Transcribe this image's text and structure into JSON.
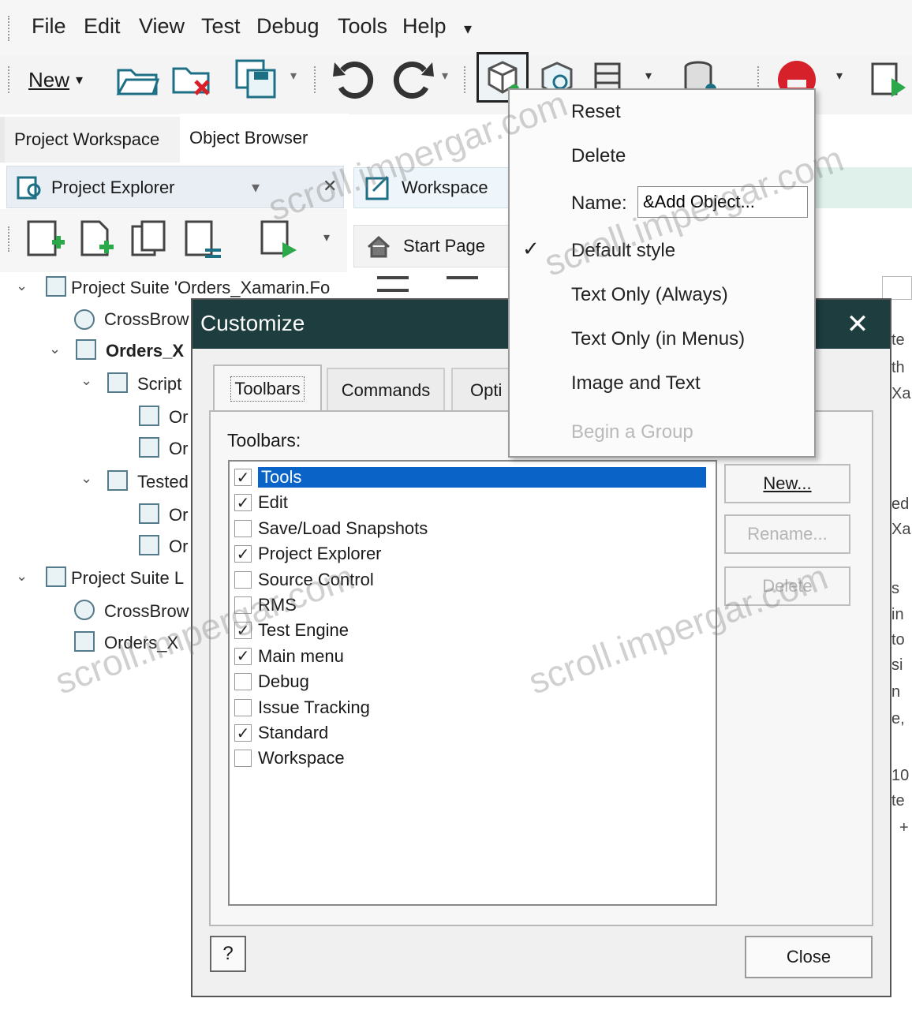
{
  "menubar": {
    "items": [
      "File",
      "Edit",
      "View",
      "Test",
      "Debug",
      "Tools",
      "Help"
    ],
    "more": "▾"
  },
  "toolbar": {
    "new_label": "New",
    "dropdown_arrow": "▾"
  },
  "left_panel": {
    "tabs": [
      "Project Workspace",
      "Object Browser"
    ],
    "explorer_title": "Project Explorer",
    "tree": [
      {
        "label": "Project Suite 'Orders_Xamarin.Fo",
        "level": 0
      },
      {
        "label": "CrossBrow",
        "level": 1
      },
      {
        "label": "Orders_X",
        "level": 1
      },
      {
        "label": "Script",
        "level": 2
      },
      {
        "label": "Or",
        "level": 3
      },
      {
        "label": "Or",
        "level": 3
      },
      {
        "label": "Tested",
        "level": 2
      },
      {
        "label": "Or",
        "level": 3
      },
      {
        "label": "Or",
        "level": 3
      },
      {
        "label": "Project Suite L",
        "level": 0
      },
      {
        "label": "CrossBrow",
        "level": 1
      },
      {
        "label": "Orders_X",
        "level": 1
      }
    ]
  },
  "workspace": {
    "tab_label": "Workspace",
    "start_page": "Start Page"
  },
  "dialog": {
    "title": "Customize",
    "close_glyph": "✕",
    "tabs": [
      "Toolbars",
      "Commands",
      "Opti"
    ],
    "toolbars_label": "Toolbars:",
    "toolbars": [
      {
        "name": "Tools",
        "checked": true,
        "selected": true
      },
      {
        "name": "Edit",
        "checked": true,
        "selected": false
      },
      {
        "name": "Save/Load Snapshots",
        "checked": false,
        "selected": false
      },
      {
        "name": "Project Explorer",
        "checked": true,
        "selected": false
      },
      {
        "name": "Source Control",
        "checked": false,
        "selected": false
      },
      {
        "name": "RMS",
        "checked": false,
        "selected": false
      },
      {
        "name": "Test Engine",
        "checked": true,
        "selected": false
      },
      {
        "name": "Main menu",
        "checked": true,
        "selected": false
      },
      {
        "name": "Debug",
        "checked": false,
        "selected": false
      },
      {
        "name": "Issue Tracking",
        "checked": false,
        "selected": false
      },
      {
        "name": "Standard",
        "checked": true,
        "selected": false
      },
      {
        "name": "Workspace",
        "checked": false,
        "selected": false
      }
    ],
    "buttons": {
      "new": "New...",
      "rename": "Rename...",
      "delete": "Delete"
    },
    "help_glyph": "?",
    "close_label": "Close"
  },
  "context_menu": {
    "items": [
      {
        "label": "Reset",
        "checked": false,
        "disabled": false
      },
      {
        "label": "Delete",
        "checked": false,
        "disabled": false
      },
      {
        "label": "Name:",
        "checked": false,
        "disabled": false
      },
      {
        "label": "Default style",
        "checked": true,
        "disabled": false
      },
      {
        "label": "Text Only (Always)",
        "checked": false,
        "disabled": false
      },
      {
        "label": "Text Only (in Menus)",
        "checked": false,
        "disabled": false
      },
      {
        "label": "Image and Text",
        "checked": false,
        "disabled": false
      },
      {
        "label": "Begin a Group",
        "checked": false,
        "disabled": true
      }
    ],
    "name_value": "&Add Object...",
    "check_glyph": "✓"
  },
  "watermark": "scroll.impergar.com",
  "colors": {
    "dialog_title_bg": "#1e3d3f",
    "selection": "#0a64c8",
    "record_red": "#d6202a"
  }
}
